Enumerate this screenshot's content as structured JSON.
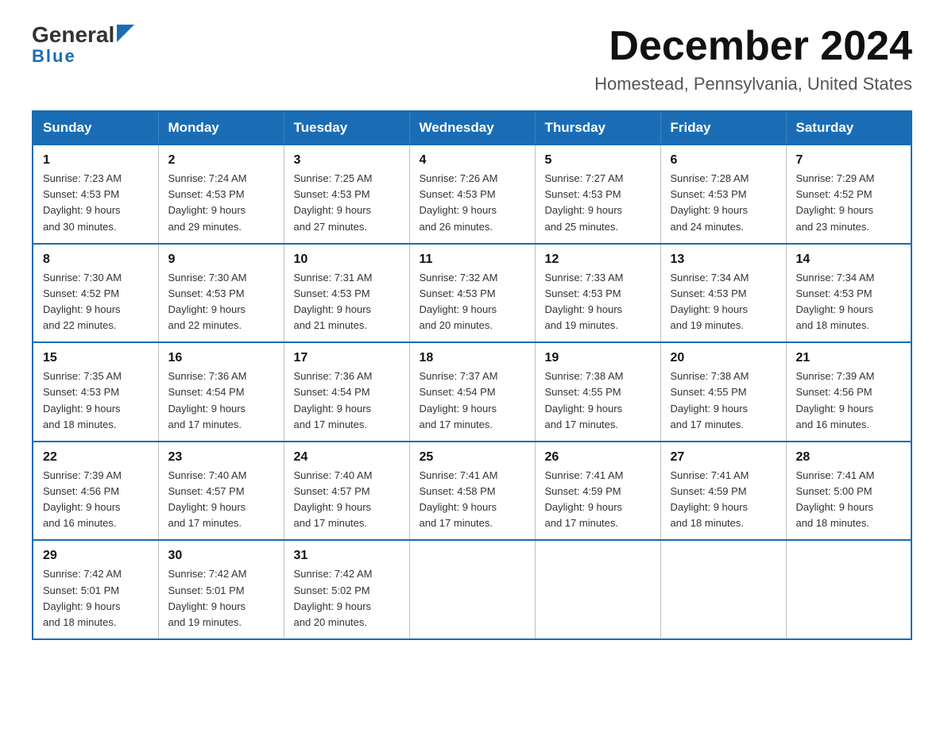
{
  "header": {
    "logo_general": "General",
    "logo_blue": "Blue",
    "main_title": "December 2024",
    "subtitle": "Homestead, Pennsylvania, United States"
  },
  "calendar": {
    "days_of_week": [
      "Sunday",
      "Monday",
      "Tuesday",
      "Wednesday",
      "Thursday",
      "Friday",
      "Saturday"
    ],
    "weeks": [
      [
        {
          "day": "1",
          "sunrise": "7:23 AM",
          "sunset": "4:53 PM",
          "daylight": "9 hours and 30 minutes."
        },
        {
          "day": "2",
          "sunrise": "7:24 AM",
          "sunset": "4:53 PM",
          "daylight": "9 hours and 29 minutes."
        },
        {
          "day": "3",
          "sunrise": "7:25 AM",
          "sunset": "4:53 PM",
          "daylight": "9 hours and 27 minutes."
        },
        {
          "day": "4",
          "sunrise": "7:26 AM",
          "sunset": "4:53 PM",
          "daylight": "9 hours and 26 minutes."
        },
        {
          "day": "5",
          "sunrise": "7:27 AM",
          "sunset": "4:53 PM",
          "daylight": "9 hours and 25 minutes."
        },
        {
          "day": "6",
          "sunrise": "7:28 AM",
          "sunset": "4:53 PM",
          "daylight": "9 hours and 24 minutes."
        },
        {
          "day": "7",
          "sunrise": "7:29 AM",
          "sunset": "4:52 PM",
          "daylight": "9 hours and 23 minutes."
        }
      ],
      [
        {
          "day": "8",
          "sunrise": "7:30 AM",
          "sunset": "4:52 PM",
          "daylight": "9 hours and 22 minutes."
        },
        {
          "day": "9",
          "sunrise": "7:30 AM",
          "sunset": "4:53 PM",
          "daylight": "9 hours and 22 minutes."
        },
        {
          "day": "10",
          "sunrise": "7:31 AM",
          "sunset": "4:53 PM",
          "daylight": "9 hours and 21 minutes."
        },
        {
          "day": "11",
          "sunrise": "7:32 AM",
          "sunset": "4:53 PM",
          "daylight": "9 hours and 20 minutes."
        },
        {
          "day": "12",
          "sunrise": "7:33 AM",
          "sunset": "4:53 PM",
          "daylight": "9 hours and 19 minutes."
        },
        {
          "day": "13",
          "sunrise": "7:34 AM",
          "sunset": "4:53 PM",
          "daylight": "9 hours and 19 minutes."
        },
        {
          "day": "14",
          "sunrise": "7:34 AM",
          "sunset": "4:53 PM",
          "daylight": "9 hours and 18 minutes."
        }
      ],
      [
        {
          "day": "15",
          "sunrise": "7:35 AM",
          "sunset": "4:53 PM",
          "daylight": "9 hours and 18 minutes."
        },
        {
          "day": "16",
          "sunrise": "7:36 AM",
          "sunset": "4:54 PM",
          "daylight": "9 hours and 17 minutes."
        },
        {
          "day": "17",
          "sunrise": "7:36 AM",
          "sunset": "4:54 PM",
          "daylight": "9 hours and 17 minutes."
        },
        {
          "day": "18",
          "sunrise": "7:37 AM",
          "sunset": "4:54 PM",
          "daylight": "9 hours and 17 minutes."
        },
        {
          "day": "19",
          "sunrise": "7:38 AM",
          "sunset": "4:55 PM",
          "daylight": "9 hours and 17 minutes."
        },
        {
          "day": "20",
          "sunrise": "7:38 AM",
          "sunset": "4:55 PM",
          "daylight": "9 hours and 17 minutes."
        },
        {
          "day": "21",
          "sunrise": "7:39 AM",
          "sunset": "4:56 PM",
          "daylight": "9 hours and 16 minutes."
        }
      ],
      [
        {
          "day": "22",
          "sunrise": "7:39 AM",
          "sunset": "4:56 PM",
          "daylight": "9 hours and 16 minutes."
        },
        {
          "day": "23",
          "sunrise": "7:40 AM",
          "sunset": "4:57 PM",
          "daylight": "9 hours and 17 minutes."
        },
        {
          "day": "24",
          "sunrise": "7:40 AM",
          "sunset": "4:57 PM",
          "daylight": "9 hours and 17 minutes."
        },
        {
          "day": "25",
          "sunrise": "7:41 AM",
          "sunset": "4:58 PM",
          "daylight": "9 hours and 17 minutes."
        },
        {
          "day": "26",
          "sunrise": "7:41 AM",
          "sunset": "4:59 PM",
          "daylight": "9 hours and 17 minutes."
        },
        {
          "day": "27",
          "sunrise": "7:41 AM",
          "sunset": "4:59 PM",
          "daylight": "9 hours and 18 minutes."
        },
        {
          "day": "28",
          "sunrise": "7:41 AM",
          "sunset": "5:00 PM",
          "daylight": "9 hours and 18 minutes."
        }
      ],
      [
        {
          "day": "29",
          "sunrise": "7:42 AM",
          "sunset": "5:01 PM",
          "daylight": "9 hours and 18 minutes."
        },
        {
          "day": "30",
          "sunrise": "7:42 AM",
          "sunset": "5:01 PM",
          "daylight": "9 hours and 19 minutes."
        },
        {
          "day": "31",
          "sunrise": "7:42 AM",
          "sunset": "5:02 PM",
          "daylight": "9 hours and 20 minutes."
        },
        null,
        null,
        null,
        null
      ]
    ],
    "sunrise_label": "Sunrise: ",
    "sunset_label": "Sunset: ",
    "daylight_label": "Daylight: "
  }
}
